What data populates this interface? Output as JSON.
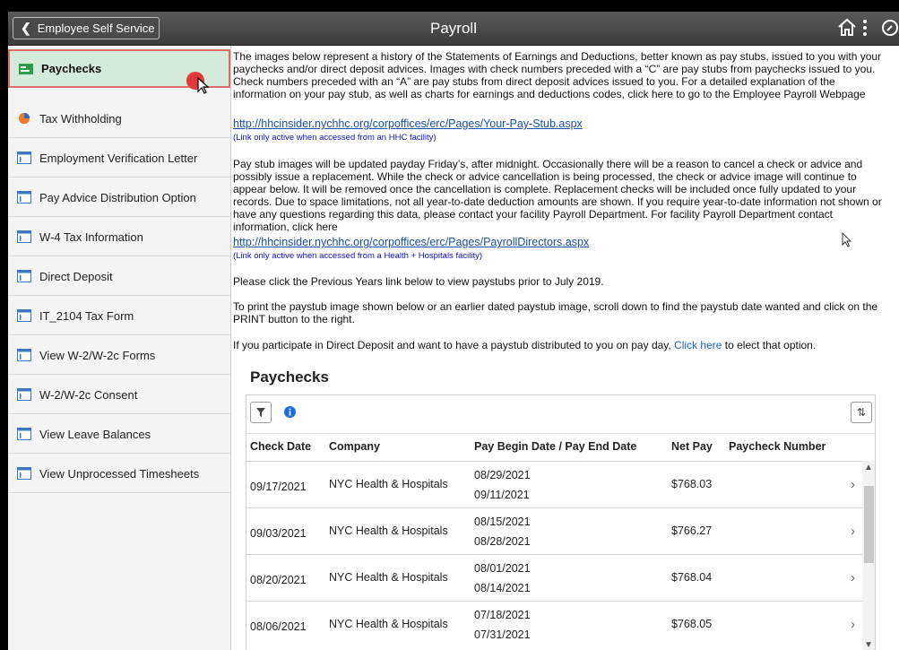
{
  "header": {
    "back_label": "Employee Self Service",
    "title": "Payroll",
    "icons": [
      "home-icon",
      "more-vertical-icon",
      "nav-compass-icon"
    ]
  },
  "sidebar": {
    "items": [
      {
        "label": "Paychecks",
        "icon": "paycheck-icon",
        "active": true
      },
      {
        "label": "Tax Withholding",
        "icon": "pie-chart-icon"
      },
      {
        "label": "Employment Verification Letter",
        "icon": "page-icon"
      },
      {
        "label": "Pay Advice Distribution Option",
        "icon": "page-icon"
      },
      {
        "label": "W-4 Tax Information",
        "icon": "page-icon"
      },
      {
        "label": "Direct Deposit",
        "icon": "page-icon"
      },
      {
        "label": "IT_2104 Tax Form",
        "icon": "page-icon"
      },
      {
        "label": "View W-2/W-2c Forms",
        "icon": "page-icon"
      },
      {
        "label": "W-2/W-2c Consent",
        "icon": "page-icon"
      },
      {
        "label": "View Leave Balances",
        "icon": "page-icon"
      },
      {
        "label": "View Unprocessed Timesheets",
        "icon": "page-icon"
      }
    ]
  },
  "content": {
    "intro": "The images below represent a history of the Statements of Earnings and Deductions, better known as pay stubs, issued to you with your paychecks and/or direct deposit advices. Images with check numbers preceded with a “C” are pay stubs from paychecks issued to you. Check numbers preceded with an “A” are pay stubs from direct deposit advices issued to you. For a detailed explanation of the information on your pay stub, as well as charts for earnings and deductions codes, click here to go to the Employee Payroll Webpage",
    "link1": "http://hhcinsider.nychhc.org/corpoffices/erc/Pages/Your-Pay-Stub.aspx",
    "link1_note": "(Link only active when accessed from an HHC facility)",
    "para2": "Pay stub images will be updated payday Friday’s, after midnight. Occasionally there will be a reason to cancel a check or advice and possibly issue a replacement. While the check or advice cancellation is being processed, the check or advice image will continue to appear below. It will be removed once the cancellation is complete. Replacement checks will be included once fully updated to your records. Due to space limitations, not all year-to-date deduction amounts are shown. If you require year-to-date information not shown or have any questions regarding this data, please contact your facility Payroll Department. For facility Payroll Department contact information, click here",
    "link2": "http://hhcinsider.nychhc.org/corpoffices/erc/Pages/PayrollDirectors.aspx",
    "link2_note": "(Link only active when accessed from a Health + Hospitals facility)",
    "para3": "Please click the Previous Years link below to view paystubs prior to July 2019.",
    "para4": "To print the paystub image shown below or an earlier dated paystub image, scroll down to find the paystub date wanted and click on the PRINT button to the right.",
    "para5_before": "If you participate in Direct Deposit and want to have a paystub distributed to you on pay day, ",
    "para5_link": "Click here",
    "para5_after": " to elect that option."
  },
  "paychecks": {
    "title": "Paychecks",
    "columns": [
      "Check Date",
      "Company",
      "Pay Begin Date / Pay End Date",
      "Net Pay",
      "Paycheck Number"
    ],
    "rows": [
      {
        "check_date": "09/17/2021",
        "company": "NYC Health & Hospitals",
        "begin": "08/29/2021",
        "end": "09/11/2021",
        "net_pay": "$768.03",
        "number": ""
      },
      {
        "check_date": "09/03/2021",
        "company": "NYC Health & Hospitals",
        "begin": "08/15/2021",
        "end": "08/28/2021",
        "net_pay": "$766.27",
        "number": ""
      },
      {
        "check_date": "08/20/2021",
        "company": "NYC Health & Hospitals",
        "begin": "08/01/2021",
        "end": "08/14/2021",
        "net_pay": "$768.04",
        "number": ""
      },
      {
        "check_date": "08/06/2021",
        "company": "NYC Health & Hospitals",
        "begin": "07/18/2021",
        "end": "07/31/2021",
        "net_pay": "$768.05",
        "number": ""
      }
    ]
  },
  "colors": {
    "active_bg": "#d5ebd9",
    "active_border": "#e06b6b",
    "link": "#1a4fa8",
    "header_bg": "#4a4a4a"
  }
}
